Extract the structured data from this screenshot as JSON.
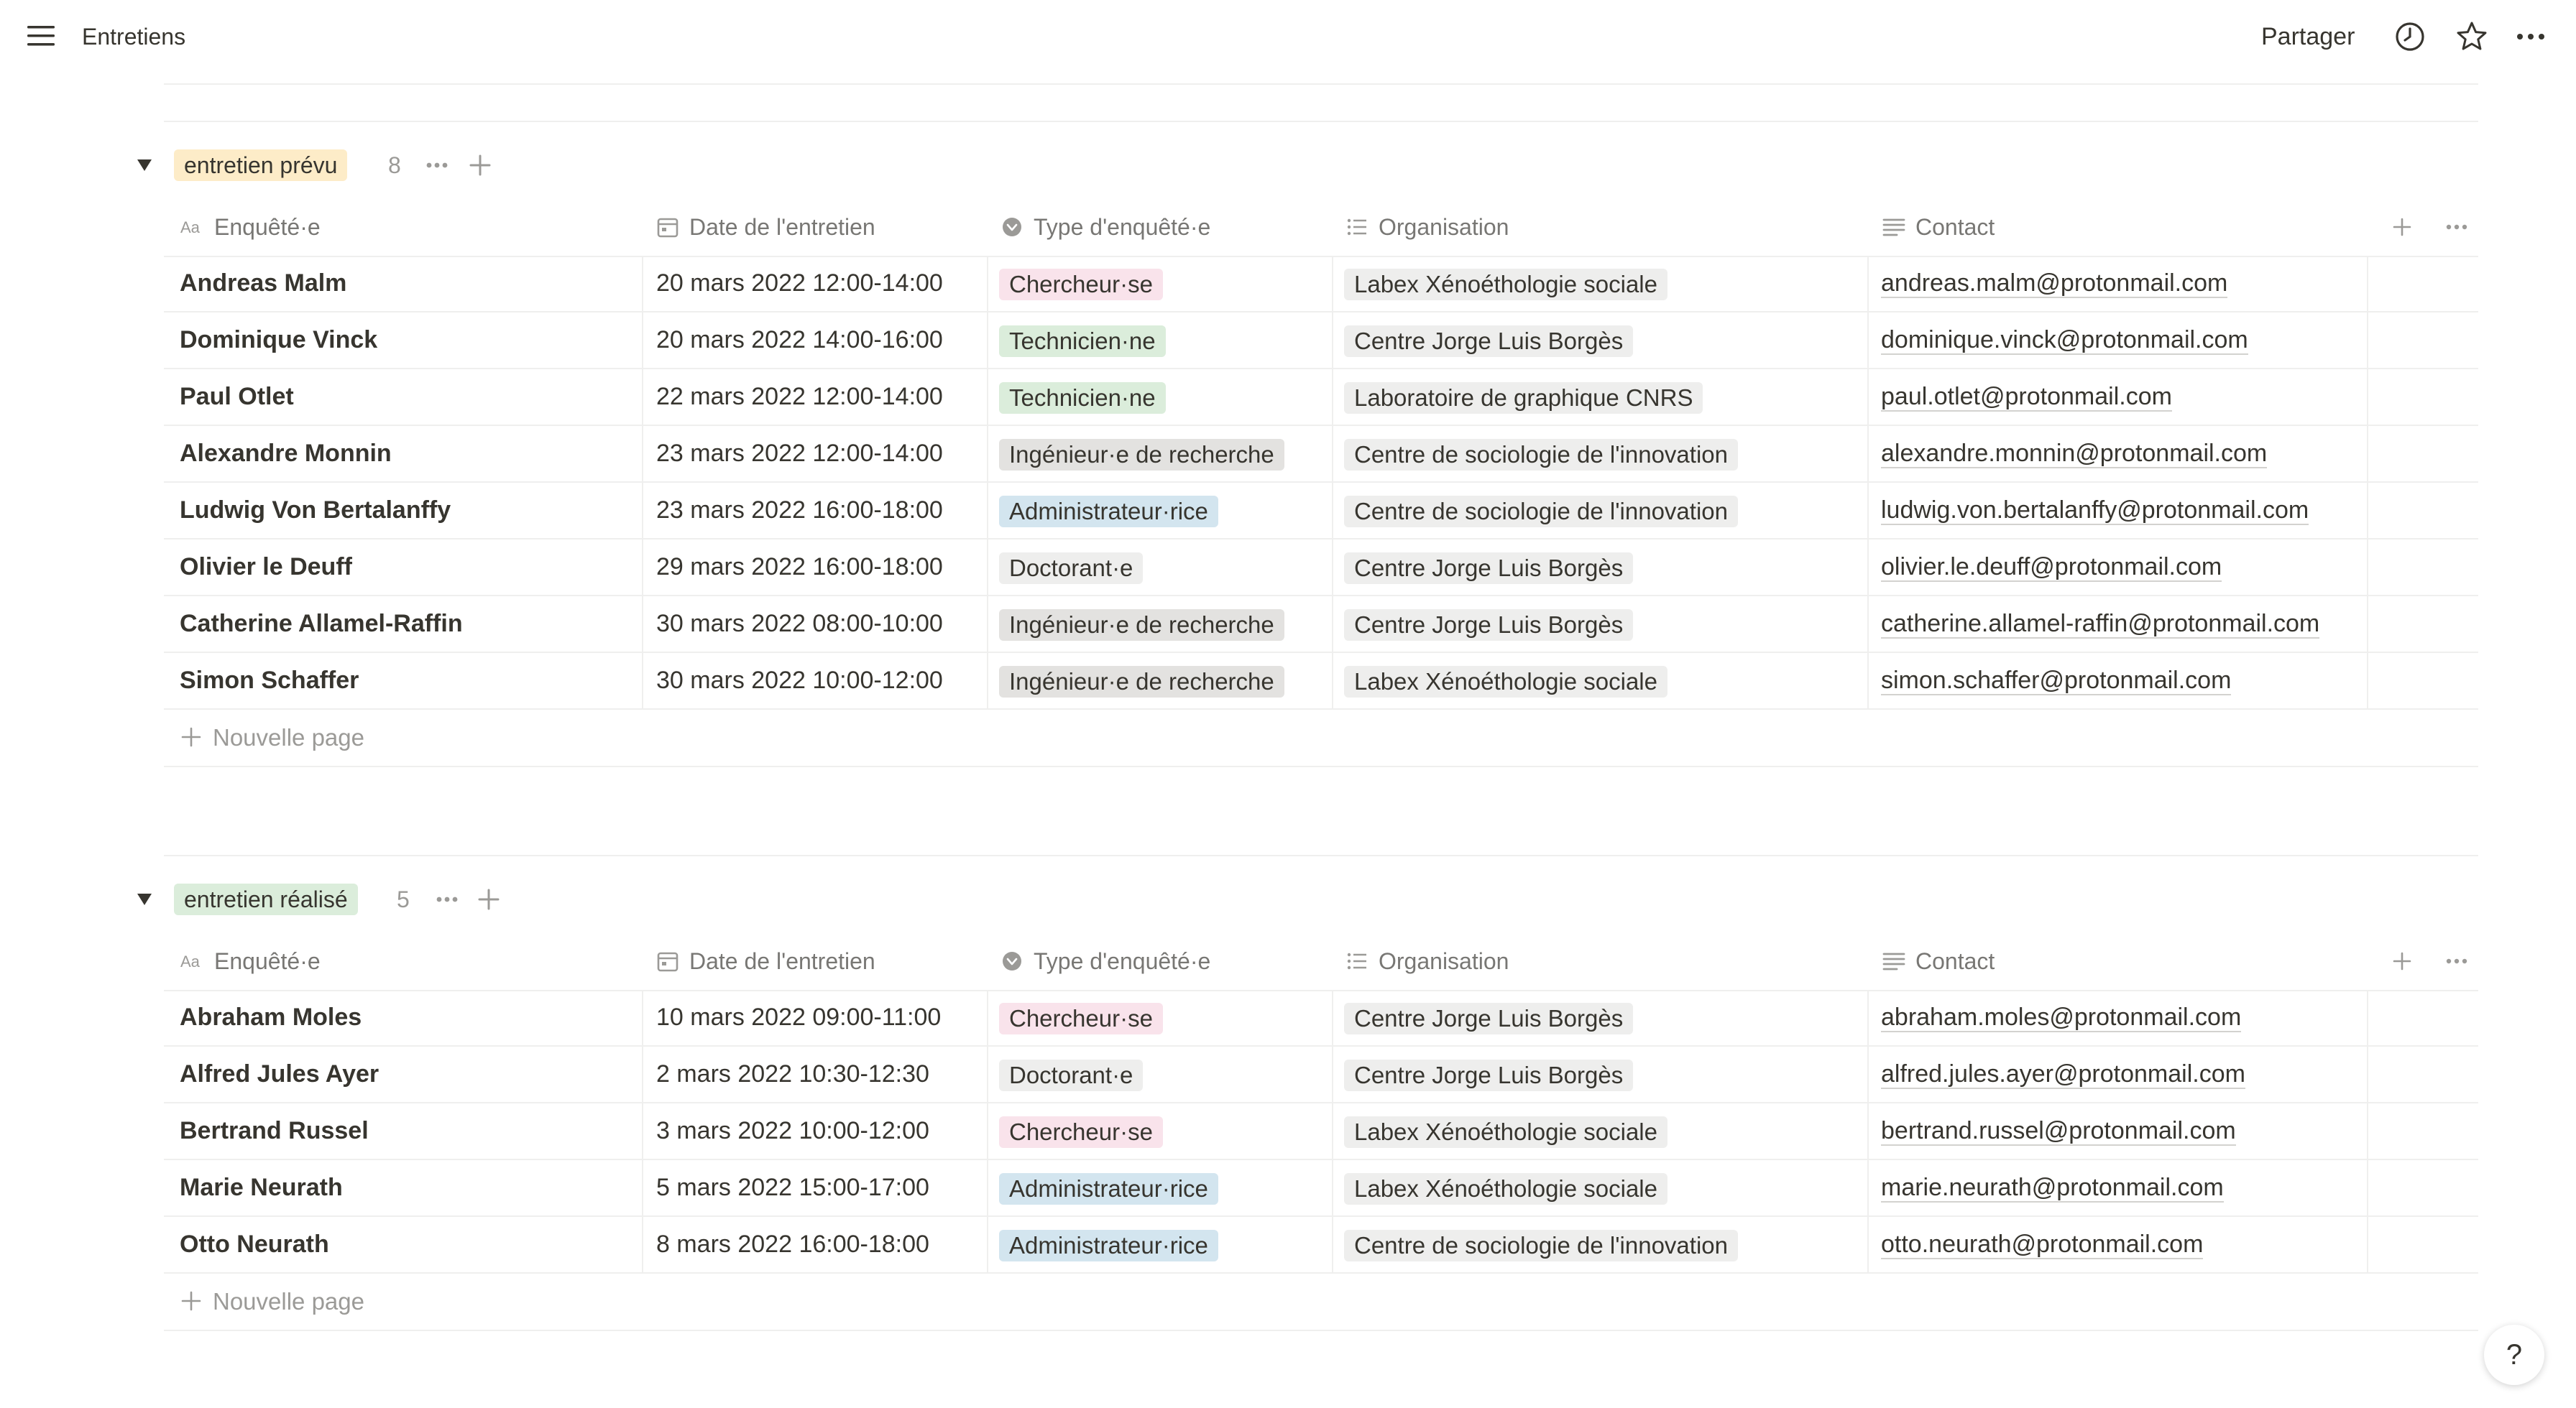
{
  "topbar": {
    "title": "Entretiens",
    "share_label": "Partager",
    "icons": [
      "menu-icon",
      "clock-icon",
      "star-icon",
      "more-icon"
    ]
  },
  "columns": [
    {
      "label": "Enquêté·e",
      "icon": "text-property-icon"
    },
    {
      "label": "Date de l'entretien",
      "icon": "calendar-icon"
    },
    {
      "label": "Type d'enquêté·e",
      "icon": "select-property-icon"
    },
    {
      "label": "Organisation",
      "icon": "list-property-icon"
    },
    {
      "label": "Contact",
      "icon": "text-lines-icon"
    }
  ],
  "colors": {
    "Chercheur·se": "#f9e3eb",
    "Technicien·ne": "#dbeddb",
    "Ingénieur·e de recherche": "#e3e2e0",
    "Administrateur·rice": "#d3e5ef",
    "Doctorant·e": "#eeeeed",
    "organisation_tag": "#eeeeed",
    "group_prevu": "#fdecc8",
    "group_realise": "#dbeddb"
  },
  "groups": [
    {
      "label": "entretien prévu",
      "count": "8",
      "new_page_label": "Nouvelle page",
      "rows": [
        {
          "name": "Andreas Malm",
          "date": "20 mars 2022 12:00-14:00",
          "type": "Chercheur·se",
          "org": "Labex Xénoéthologie sociale",
          "contact": "andreas.malm@protonmail.com"
        },
        {
          "name": "Dominique Vinck",
          "date": "20 mars 2022 14:00-16:00",
          "type": "Technicien·ne",
          "org": "Centre Jorge Luis Borgès",
          "contact": "dominique.vinck@protonmail.com"
        },
        {
          "name": "Paul Otlet",
          "date": "22 mars 2022 12:00-14:00",
          "type": "Technicien·ne",
          "org": "Laboratoire de graphique CNRS",
          "contact": "paul.otlet@protonmail.com"
        },
        {
          "name": "Alexandre Monnin",
          "date": "23 mars 2022 12:00-14:00",
          "type": "Ingénieur·e de recherche",
          "org": "Centre de sociologie de l'innovation",
          "contact": "alexandre.monnin@protonmail.com"
        },
        {
          "name": "Ludwig Von Bertalanffy",
          "date": "23 mars 2022 16:00-18:00",
          "type": "Administrateur·rice",
          "org": "Centre de sociologie de l'innovation",
          "contact": "ludwig.von.bertalanffy@protonmail.com"
        },
        {
          "name": "Olivier le Deuff",
          "date": "29 mars 2022 16:00-18:00",
          "type": "Doctorant·e",
          "org": "Centre Jorge Luis Borgès",
          "contact": "olivier.le.deuff@protonmail.com"
        },
        {
          "name": "Catherine Allamel-Raffin",
          "date": "30 mars 2022 08:00-10:00",
          "type": "Ingénieur·e de recherche",
          "org": "Centre Jorge Luis Borgès",
          "contact": "catherine.allamel-raffin@protonmail.com"
        },
        {
          "name": "Simon Schaffer",
          "date": "30 mars 2022 10:00-12:00",
          "type": "Ingénieur·e de recherche",
          "org": "Labex Xénoéthologie sociale",
          "contact": "simon.schaffer@protonmail.com"
        }
      ]
    },
    {
      "label": "entretien réalisé",
      "count": "5",
      "new_page_label": "Nouvelle page",
      "rows": [
        {
          "name": "Abraham Moles",
          "date": "10 mars 2022 09:00-11:00",
          "type": "Chercheur·se",
          "org": "Centre Jorge Luis Borgès",
          "contact": "abraham.moles@protonmail.com"
        },
        {
          "name": "Alfred Jules Ayer",
          "date": "2 mars 2022 10:30-12:30",
          "type": "Doctorant·e",
          "org": "Centre Jorge Luis Borgès",
          "contact": "alfred.jules.ayer@protonmail.com"
        },
        {
          "name": "Bertrand Russel",
          "date": "3 mars 2022 10:00-12:00",
          "type": "Chercheur·se",
          "org": "Labex Xénoéthologie sociale",
          "contact": "bertrand.russel@protonmail.com"
        },
        {
          "name": "Marie Neurath",
          "date": "5 mars 2022 15:00-17:00",
          "type": "Administrateur·rice",
          "org": "Labex Xénoéthologie sociale",
          "contact": "marie.neurath@protonmail.com"
        },
        {
          "name": "Otto Neurath",
          "date": "8 mars 2022 16:00-18:00",
          "type": "Administrateur·rice",
          "org": "Centre de sociologie de l'innovation",
          "contact": "otto.neurath@protonmail.com"
        }
      ]
    }
  ],
  "help_label": "?"
}
